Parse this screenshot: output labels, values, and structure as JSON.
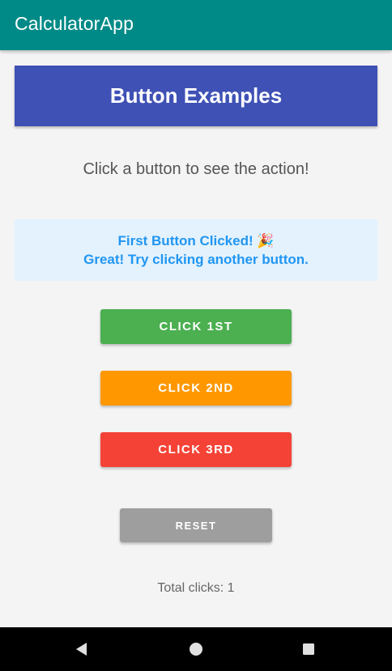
{
  "app_bar": {
    "title": "CalculatorApp",
    "background": "#008a87"
  },
  "header": {
    "title": "Button Examples",
    "background": "#3f51b5"
  },
  "instruction": "Click a button to see the action!",
  "message": {
    "line1": "First Button Clicked! 🎉",
    "line2": "Great! Try clicking another button.",
    "background": "#e3f2fd",
    "text_color": "#2196f3"
  },
  "buttons": [
    {
      "label": "CLICK 1ST",
      "color": "#4caf50"
    },
    {
      "label": "CLICK 2ND",
      "color": "#ff9800"
    },
    {
      "label": "CLICK 3RD",
      "color": "#f44336"
    }
  ],
  "reset": {
    "label": "RESET",
    "color": "#9e9e9e"
  },
  "total_clicks": "Total clicks: 1",
  "nav": {
    "back_icon": "back-triangle-icon",
    "home_icon": "home-circle-icon",
    "recent_icon": "recent-apps-square-icon"
  }
}
